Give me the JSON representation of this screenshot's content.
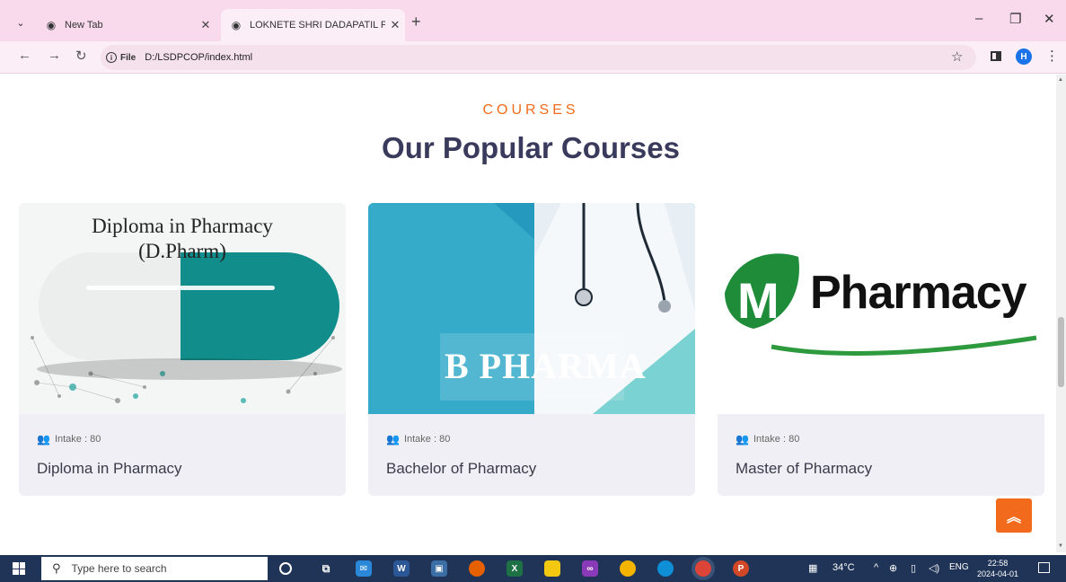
{
  "browser": {
    "tabs": [
      {
        "title": "New Tab"
      },
      {
        "title": "LOKNETE SHRI DADAPATIL PHA"
      }
    ],
    "address": {
      "scheme_label": "File",
      "url": "D:/LSDPCOP/index.html"
    },
    "profile_initial": "H"
  },
  "page": {
    "kicker": "COURSES",
    "title": "Our Popular Courses",
    "courses": [
      {
        "image_text_line1": "Diploma in Pharmacy",
        "image_text_line2": "(D.Pharm)",
        "intake": "Intake : 80",
        "name": "Diploma in Pharmacy"
      },
      {
        "image_text": "B PHARMA",
        "intake": "Intake : 80",
        "name": "Bachelor of Pharmacy"
      },
      {
        "image_text": "Pharmacy",
        "intake": "Intake : 80",
        "name": "Master of Pharmacy"
      }
    ]
  },
  "taskbar": {
    "search_placeholder": "Type here to search",
    "weather": "34°C",
    "language": "ENG",
    "time": "22:58",
    "date": "2024-04-01"
  },
  "colors": {
    "accent": "#f06b1c",
    "heading": "#3a3b5c",
    "tabbar": "#f9d9ec",
    "taskbar": "#1f3456"
  }
}
